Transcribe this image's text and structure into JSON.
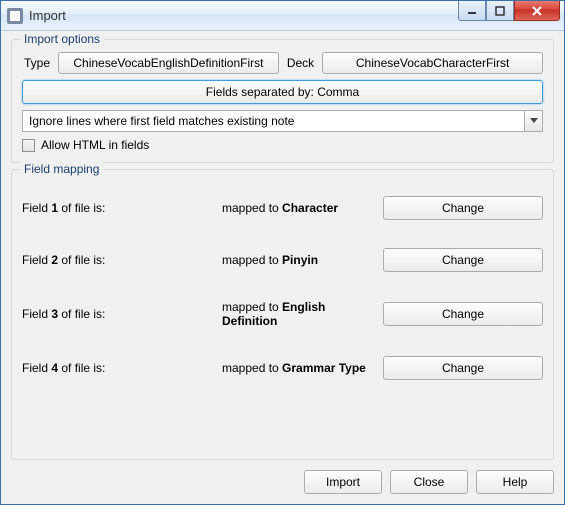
{
  "window": {
    "title": "Import"
  },
  "options": {
    "group_title": "Import options",
    "type_label": "Type",
    "type_value": "ChineseVocabEnglishDefinitionFirst",
    "deck_label": "Deck",
    "deck_value": "ChineseVocabCharacterFirst",
    "separator_button": "Fields separated by: Comma",
    "dup_mode": "Ignore lines where first field matches existing note",
    "allow_html_label": "Allow HTML in fields",
    "allow_html_checked": false
  },
  "mapping": {
    "group_title": "Field mapping",
    "prefix": "Field ",
    "suffix": " of file is:",
    "mapped_prefix": "mapped to ",
    "change_label": "Change",
    "rows": [
      {
        "num": "1",
        "target": "Character"
      },
      {
        "num": "2",
        "target": "Pinyin"
      },
      {
        "num": "3",
        "target": "English Definition"
      },
      {
        "num": "4",
        "target": "Grammar Type"
      }
    ]
  },
  "footer": {
    "import": "Import",
    "close": "Close",
    "help": "Help"
  }
}
